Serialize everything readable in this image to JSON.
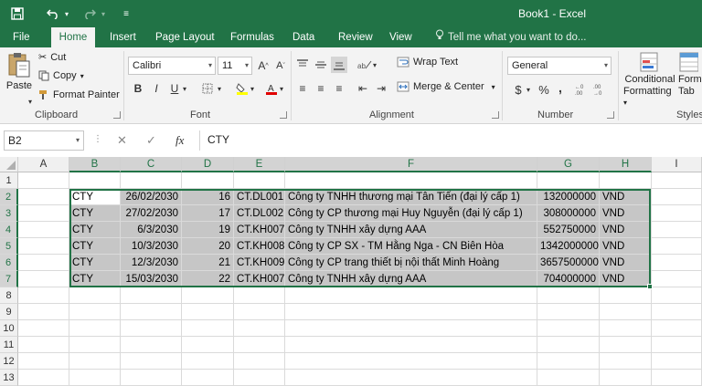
{
  "title": "Book1 - Excel",
  "colors": {
    "accent": "#217346",
    "selection": "#c6c6c6"
  },
  "quick_access": {
    "save_icon": "save-icon",
    "undo_icon": "undo-icon",
    "redo_icon": "redo-icon",
    "customize_icon": "customize-icon"
  },
  "tabs": [
    "File",
    "Home",
    "Insert",
    "Page Layout",
    "Formulas",
    "Data",
    "Review",
    "View"
  ],
  "active_tab": "Home",
  "tell_me": "Tell me what you want to do...",
  "clipboard": {
    "paste": "Paste",
    "cut": "Cut",
    "copy": "Copy",
    "format_painter": "Format Painter",
    "label": "Clipboard"
  },
  "font": {
    "name": "Calibri",
    "size": "11",
    "bold": "B",
    "italic": "I",
    "underline": "U",
    "label": "Font"
  },
  "alignment": {
    "wrap_text": "Wrap Text",
    "merge_center": "Merge & Center",
    "label": "Alignment"
  },
  "number": {
    "format": "General",
    "currency": "$",
    "percent": "%",
    "comma": ",",
    "label": "Number"
  },
  "styles": {
    "conditional": "Conditional",
    "formatting": "Formatting",
    "format_as": "Form",
    "table": "Tab",
    "label": "Styles"
  },
  "formula_bar": {
    "name_box": "B2",
    "cancel": "✕",
    "enter": "✓",
    "fx": "fx",
    "value": "CTY"
  },
  "columns": [
    "A",
    "B",
    "C",
    "D",
    "E",
    "F",
    "G",
    "H",
    "I"
  ],
  "rows": [
    "1",
    "2",
    "3",
    "4",
    "5",
    "6",
    "7",
    "8",
    "9",
    "10",
    "11",
    "12",
    "13"
  ],
  "data_rows": [
    [
      "CTY",
      "26/02/2030",
      "16",
      "CT.DL001",
      "Công ty TNHH thương mại Tân Tiến (đại lý cấp 1)",
      "132000000",
      "VND"
    ],
    [
      "CTY",
      "27/02/2030",
      "17",
      "CT.DL002",
      "Công ty CP thương mại Huy Nguyễn (đại lý cấp 1)",
      "308000000",
      "VND"
    ],
    [
      "CTY",
      "6/3/2030",
      "19",
      "CT.KH007",
      "Công ty TNHH xây dựng AAA",
      "552750000",
      "VND"
    ],
    [
      "CTY",
      "10/3/2030",
      "20",
      "CT.KH008",
      "Công ty CP SX - TM Hằng Nga - CN Biên Hòa",
      "1342000000",
      "VND"
    ],
    [
      "CTY",
      "12/3/2030",
      "21",
      "CT.KH009",
      "Công ty CP trang thiết bị nội thất Minh Hoàng",
      "3657500000",
      "VND"
    ],
    [
      "CTY",
      "15/03/2030",
      "22",
      "CT.KH007",
      "Công ty TNHH xây dựng AAA",
      "704000000",
      "VND"
    ]
  ]
}
